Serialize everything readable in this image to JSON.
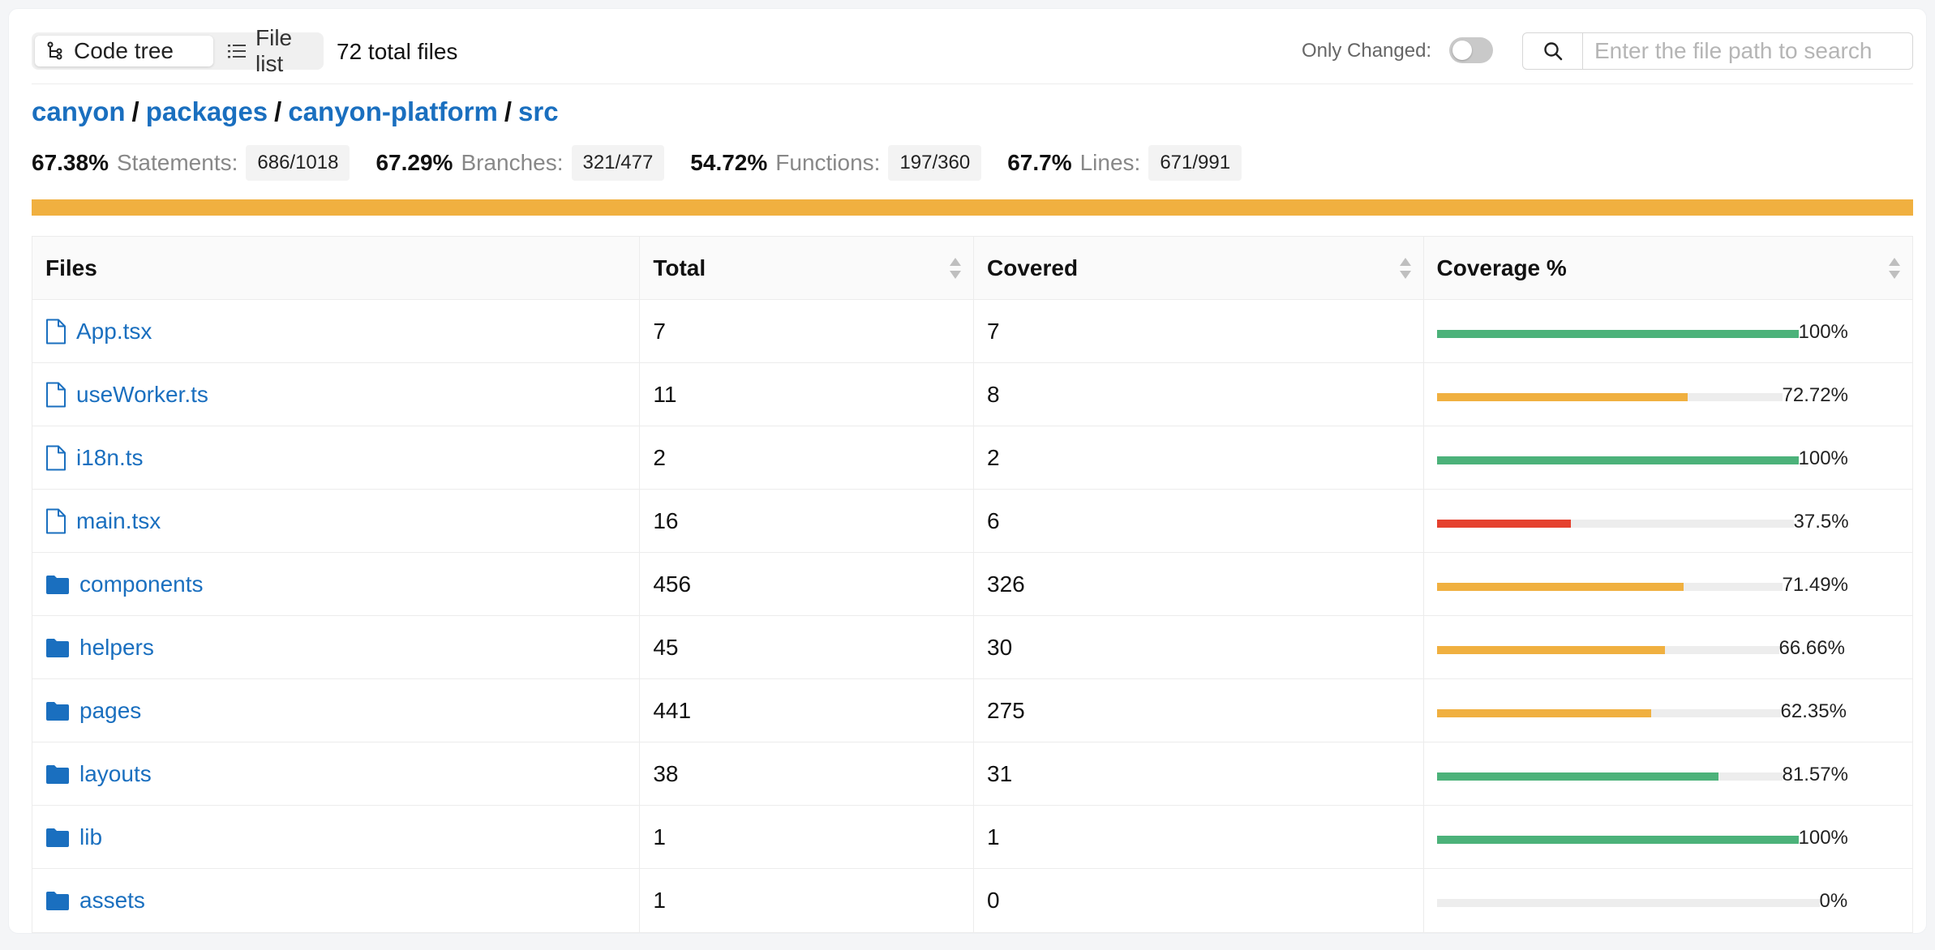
{
  "toolbar": {
    "view_tabs": [
      {
        "label": "Code tree",
        "active": true,
        "icon": "tree-icon"
      },
      {
        "label": "File list",
        "active": false,
        "icon": "list-icon"
      }
    ],
    "total_files": "72 total files",
    "only_changed_label": "Only Changed:",
    "only_changed_on": false,
    "search": {
      "placeholder": "Enter the file path to search",
      "value": ""
    }
  },
  "breadcrumb": [
    "canyon",
    "packages",
    "canyon-platform",
    "src"
  ],
  "summary": [
    {
      "pct": "67.38%",
      "label": "Statements:",
      "count": "686/1018"
    },
    {
      "pct": "67.29%",
      "label": "Branches:",
      "count": "321/477"
    },
    {
      "pct": "54.72%",
      "label": "Functions:",
      "count": "197/360"
    },
    {
      "pct": "67.7%",
      "label": "Lines:",
      "count": "671/991"
    }
  ],
  "overall_bar": {
    "fraction": 1.0,
    "color": "#f0b040"
  },
  "colors": {
    "green": "#4cb27a",
    "orange": "#f0b040",
    "red": "#e5412e",
    "track": "#ededed",
    "link": "#1a6fbf"
  },
  "table": {
    "headers": {
      "files": "Files",
      "total": "Total",
      "covered": "Covered",
      "coverage": "Coverage %"
    },
    "rows": [
      {
        "name": "App.tsx",
        "type": "file",
        "total": "7",
        "covered": "7",
        "pct": "100%",
        "fraction": 1.0,
        "status": "green"
      },
      {
        "name": "useWorker.ts",
        "type": "file",
        "total": "11",
        "covered": "8",
        "pct": "72.72%",
        "fraction": 0.7272,
        "status": "orange"
      },
      {
        "name": "i18n.ts",
        "type": "file",
        "total": "2",
        "covered": "2",
        "pct": "100%",
        "fraction": 1.0,
        "status": "green"
      },
      {
        "name": "main.tsx",
        "type": "file",
        "total": "16",
        "covered": "6",
        "pct": "37.5%",
        "fraction": 0.375,
        "status": "red"
      },
      {
        "name": "components",
        "type": "folder",
        "total": "456",
        "covered": "326",
        "pct": "71.49%",
        "fraction": 0.7149,
        "status": "orange"
      },
      {
        "name": "helpers",
        "type": "folder",
        "total": "45",
        "covered": "30",
        "pct": "66.66%",
        "fraction": 0.6666,
        "status": "orange"
      },
      {
        "name": "pages",
        "type": "folder",
        "total": "441",
        "covered": "275",
        "pct": "62.35%",
        "fraction": 0.6235,
        "status": "orange"
      },
      {
        "name": "layouts",
        "type": "folder",
        "total": "38",
        "covered": "31",
        "pct": "81.57%",
        "fraction": 0.8157,
        "status": "green"
      },
      {
        "name": "lib",
        "type": "folder",
        "total": "1",
        "covered": "1",
        "pct": "100%",
        "fraction": 1.0,
        "status": "green"
      },
      {
        "name": "assets",
        "type": "folder",
        "total": "1",
        "covered": "0",
        "pct": "0%",
        "fraction": 0.0,
        "status": "none"
      }
    ]
  }
}
